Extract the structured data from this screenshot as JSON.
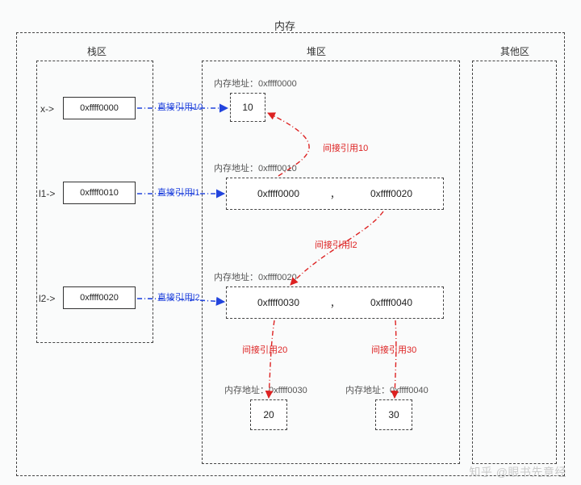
{
  "title": "内存",
  "sections": {
    "outer_caption": "内存",
    "stack_caption": "栈区",
    "heap_caption": "堆区",
    "other_caption": "其他区"
  },
  "stack": {
    "x": {
      "ptr_label": "x->",
      "address": "0xffff0000"
    },
    "l1": {
      "ptr_label": "l1->",
      "address": "0xffff0010"
    },
    "l2": {
      "ptr_label": "l2->",
      "address": "0xffff0020"
    }
  },
  "heap": {
    "obj_10": {
      "addr_prefix": "内存地址：",
      "address": "0xffff0000",
      "display": "10"
    },
    "obj_l1": {
      "addr_prefix": "内存地址：",
      "address": "0xffff0010",
      "display_a": "0xffff0000",
      "sep": "，",
      "display_b": "0xffff0020"
    },
    "obj_l2": {
      "addr_prefix": "内存地址：",
      "address": "0xffff0020",
      "display_a": "0xffff0030",
      "sep": "，",
      "display_b": "0xffff0040"
    },
    "obj_20": {
      "addr_prefix": "内存地址：",
      "address": "0xffff0030",
      "display": "20"
    },
    "obj_30": {
      "addr_prefix": "内存地址：",
      "address": "0xffff0040",
      "display": "30"
    }
  },
  "edges": {
    "x_direct": "直接引用10",
    "l1_direct": "直接引用l1",
    "l2_direct": "直接引用l2",
    "l1_ind_10": "间接引用10",
    "l1_ind_l2": "间接引用l2",
    "l2_ind_20": "间接引用20",
    "l2_ind_30": "间接引用30"
  },
  "watermark": "知乎 @眼书先意经"
}
